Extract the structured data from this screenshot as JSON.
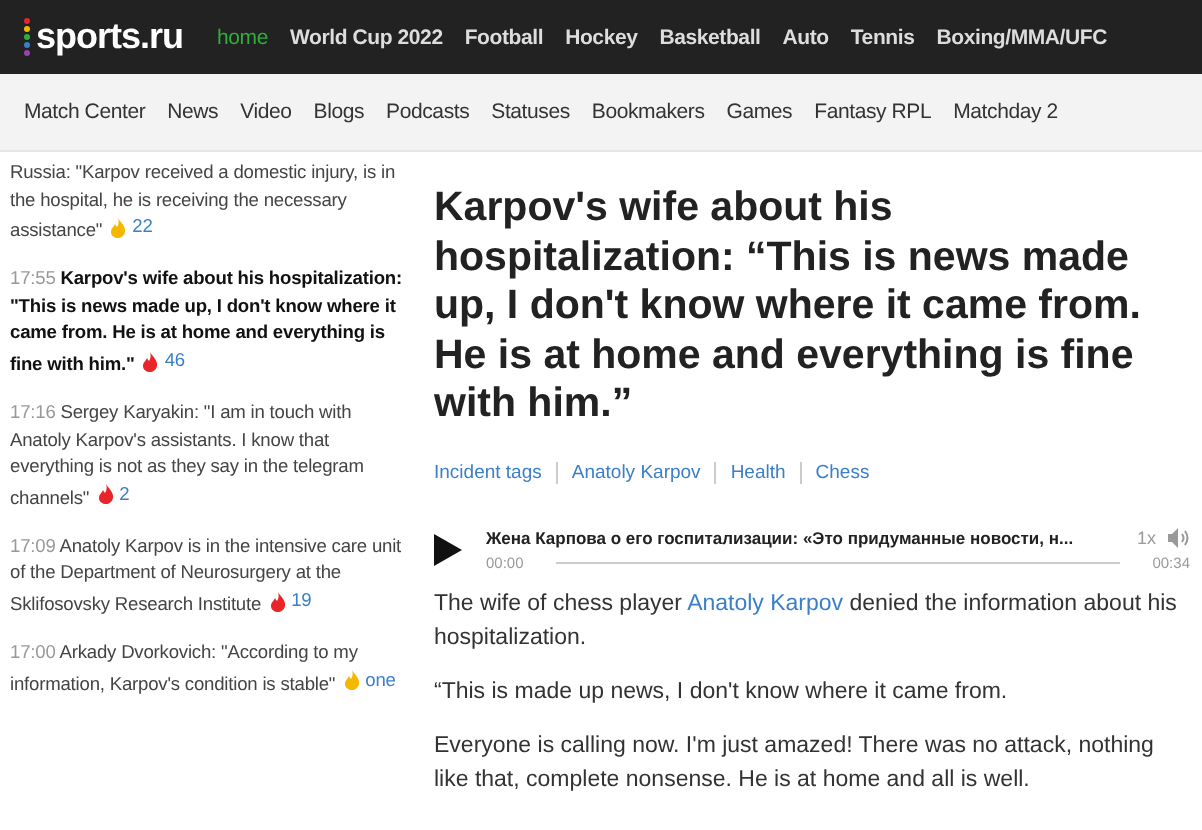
{
  "top_nav": {
    "logo": "sports.ru",
    "items": [
      {
        "label": "home",
        "selected": true
      },
      {
        "label": "World Cup 2022",
        "selected": false
      },
      {
        "label": "Football",
        "selected": false
      },
      {
        "label": "Hockey",
        "selected": false
      },
      {
        "label": "Basketball",
        "selected": false
      },
      {
        "label": "Auto",
        "selected": false
      },
      {
        "label": "Tennis",
        "selected": false
      },
      {
        "label": "Boxing/MMA/UFC",
        "selected": false
      }
    ]
  },
  "sub_nav": [
    "Match Center",
    "News",
    "Video",
    "Blogs",
    "Podcasts",
    "Statuses",
    "Bookmakers",
    "Games",
    "Fantasy RPL",
    "Matchday 2"
  ],
  "news_feed": [
    {
      "text": "Russia: \"Karpov received a domestic injury, is in the hospital, he is receiving the necessary assistance\"",
      "selected": false,
      "color": "#f5b800",
      "count": "22"
    },
    {
      "time": "17:55",
      "text": "Karpov's wife about his hospitalization: \"This is news made up, I don't know where it came from. He is at home and everything is fine with him.\"",
      "selected": true,
      "color": "#e8262a",
      "count": "46"
    },
    {
      "time": "17:16",
      "text": "Sergey Karyakin: \"I am in touch with Anatoly Karpov's assistants. I know that everything is not as they say in the telegram channels\"",
      "selected": false,
      "color": "#e8262a",
      "count": "2"
    },
    {
      "time": "17:09",
      "text": "Anatoly Karpov is in the intensive care unit of the Department of Neurosurgery at the Sklifosovsky Research Institute",
      "selected": false,
      "color": "#e8262a",
      "count": "19"
    },
    {
      "time": "17:00",
      "text": "Arkady Dvorkovich: \"According to my information, Karpov's condition is stable\"",
      "selected": false,
      "color": "#f5b800",
      "count": "one"
    }
  ],
  "article": {
    "headline": "Karpov's wife about his hospitalization: “This is news made up, I don't know where it came from. He is at home and everything is fine with him.”",
    "tags": [
      "Incident tags",
      "Anatoly Karpov",
      "Health",
      "Chess"
    ],
    "audio": {
      "title": "Жена Карпова о его госпитализации: «Это придуманные новости, н...",
      "speed": "1x",
      "elapsed": "00:00",
      "duration": "00:34",
      "level": 0
    },
    "paragraphs": [
      [
        {
          "text": "The wife of chess player "
        },
        {
          "text": "Anatoly Karpov",
          "link": true
        },
        {
          "text": " denied the information about his hospitalization."
        }
      ],
      [
        {
          "text": "“This is made up news, I don't know where it came from."
        }
      ],
      [
        {
          "text": "Everyone is calling now. I'm just amazed! There was no attack, nothing like that, complete nonsense. He is at home and all is well."
        }
      ]
    ]
  }
}
